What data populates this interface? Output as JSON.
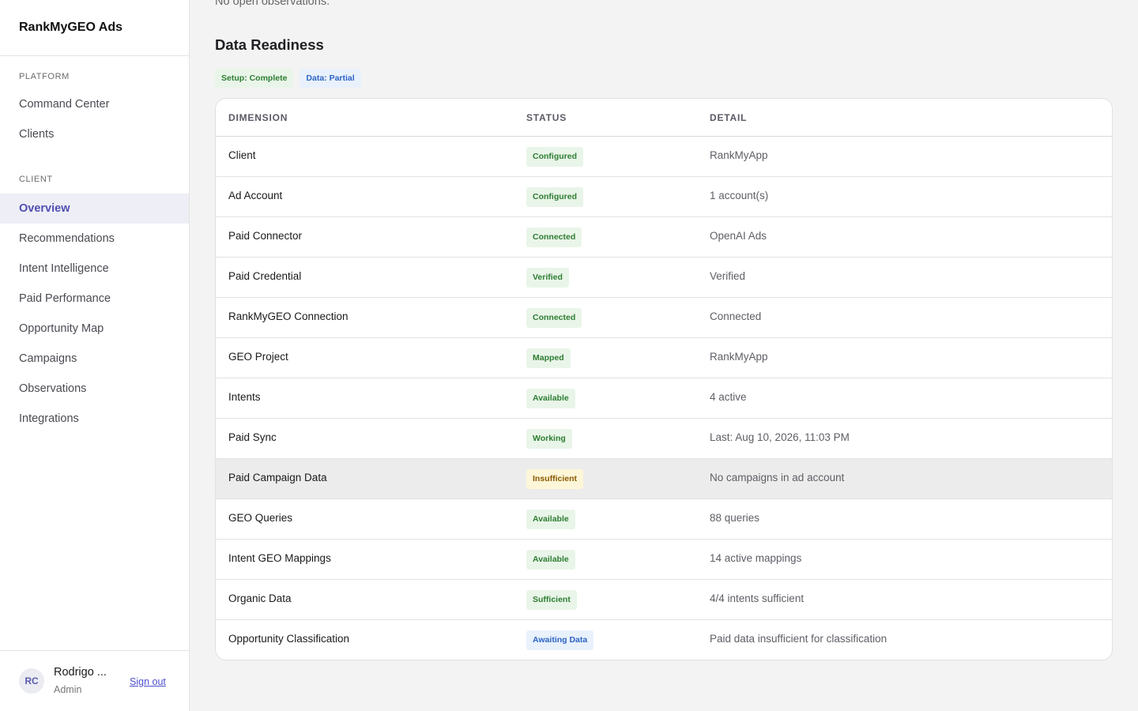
{
  "app": {
    "brand": "RankMyGEO Ads"
  },
  "sidebar": {
    "platform_label": "PLATFORM",
    "platform_items": [
      {
        "label": "Command Center"
      },
      {
        "label": "Clients"
      }
    ],
    "client_label": "CLIENT",
    "client_items": [
      {
        "label": "Overview",
        "active": true
      },
      {
        "label": "Recommendations"
      },
      {
        "label": "Intent Intelligence"
      },
      {
        "label": "Paid Performance"
      },
      {
        "label": "Opportunity Map"
      },
      {
        "label": "Campaigns"
      },
      {
        "label": "Observations"
      },
      {
        "label": "Integrations"
      }
    ],
    "user": {
      "initials": "RC",
      "name": "Rodrigo ...",
      "role": "Admin",
      "signout": "Sign out"
    }
  },
  "main": {
    "prev_section_text": "No open observations.",
    "section_title": "Data Readiness",
    "pills": {
      "setup": "Setup: Complete",
      "data": "Data: Partial"
    },
    "table": {
      "headers": {
        "dimension": "DIMENSION",
        "status": "STATUS",
        "detail": "DETAIL"
      },
      "rows": [
        {
          "dimension": "Client",
          "status": "Configured",
          "tone": "green",
          "detail": "RankMyApp"
        },
        {
          "dimension": "Ad Account",
          "status": "Configured",
          "tone": "green",
          "detail": "1 account(s)"
        },
        {
          "dimension": "Paid Connector",
          "status": "Connected",
          "tone": "green",
          "detail": "OpenAI Ads"
        },
        {
          "dimension": "Paid Credential",
          "status": "Verified",
          "tone": "green",
          "detail": "Verified"
        },
        {
          "dimension": "RankMyGEO Connection",
          "status": "Connected",
          "tone": "green",
          "detail": "Connected"
        },
        {
          "dimension": "GEO Project",
          "status": "Mapped",
          "tone": "green",
          "detail": "RankMyApp"
        },
        {
          "dimension": "Intents",
          "status": "Available",
          "tone": "green",
          "detail": "4 active"
        },
        {
          "dimension": "Paid Sync",
          "status": "Working",
          "tone": "green",
          "detail": "Last: Aug 10, 2026, 11:03 PM"
        },
        {
          "dimension": "Paid Campaign Data",
          "status": "Insufficient",
          "tone": "yellow",
          "detail": "No campaigns in ad account"
        },
        {
          "dimension": "GEO Queries",
          "status": "Available",
          "tone": "green",
          "detail": "88 queries"
        },
        {
          "dimension": "Intent GEO Mappings",
          "status": "Available",
          "tone": "green",
          "detail": "14 active mappings"
        },
        {
          "dimension": "Organic Data",
          "status": "Sufficient",
          "tone": "green",
          "detail": "4/4 intents sufficient"
        },
        {
          "dimension": "Opportunity Classification",
          "status": "Awaiting Data",
          "tone": "blue",
          "detail": "Paid data insufficient for classification"
        }
      ]
    }
  }
}
